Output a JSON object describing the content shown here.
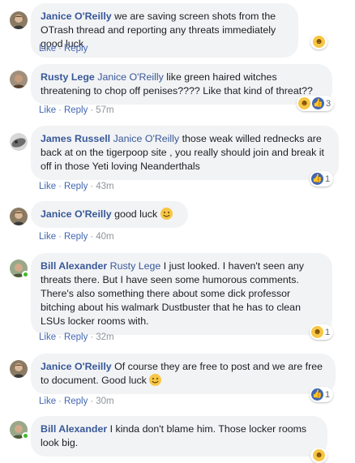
{
  "action_labels": {
    "like": "Like",
    "reply": "Reply",
    "separator": "·"
  },
  "comments": [
    {
      "author": "Janice O'Reilly",
      "mention": "",
      "text": "we are saving screen shots from the OTrash thread and reporting any threats immediately good luck",
      "time": "",
      "reaction_count": "",
      "reactions": [
        "haha-icon"
      ]
    },
    {
      "author": "Rusty Lege",
      "mention": "Janice O'Reilly",
      "text": "like green haired witches threatening to chop off penises???? Like that kind of threat??",
      "time": "57m",
      "reaction_count": "3",
      "reactions": [
        "haha-icon",
        "like-icon"
      ]
    },
    {
      "author": "James Russell",
      "mention": "Janice O'Reilly",
      "text": "those weak willed rednecks are back at on the tigerpoop site , you really should join and break it off in those Yeti loving Neanderthals",
      "time": "43m",
      "reaction_count": "1",
      "reactions": [
        "like-icon"
      ]
    },
    {
      "author": "Janice O'Reilly",
      "mention": "",
      "text": "good luck",
      "time": "40m",
      "reaction_count": "",
      "reactions": []
    },
    {
      "author": "Bill Alexander",
      "mention": "Rusty Lege",
      "text": "I just looked. I haven't seen any threats there. But I have seen some humorous comments. There's also something there about some dick professor bitching about his walmark Dustbuster that he has to clean LSUs locker rooms with.",
      "time": "32m",
      "reaction_count": "1",
      "reactions": [
        "haha-icon"
      ]
    },
    {
      "author": "Janice O'Reilly",
      "mention": "",
      "text": "Of course they are free to post and we are free to document. Good luck",
      "time": "30m",
      "reaction_count": "1",
      "reactions": [
        "like-icon"
      ]
    },
    {
      "author": "Bill Alexander",
      "mention": "",
      "text": "I kinda don't blame him. Those locker rooms look big.",
      "time": "",
      "reaction_count": "",
      "reactions": [
        "haha-icon"
      ]
    }
  ],
  "colors": {
    "link": "#385898",
    "bubble": "#f2f3f5",
    "like": "#4267b2",
    "haha": "#f7c645",
    "online": "#42b72a"
  }
}
